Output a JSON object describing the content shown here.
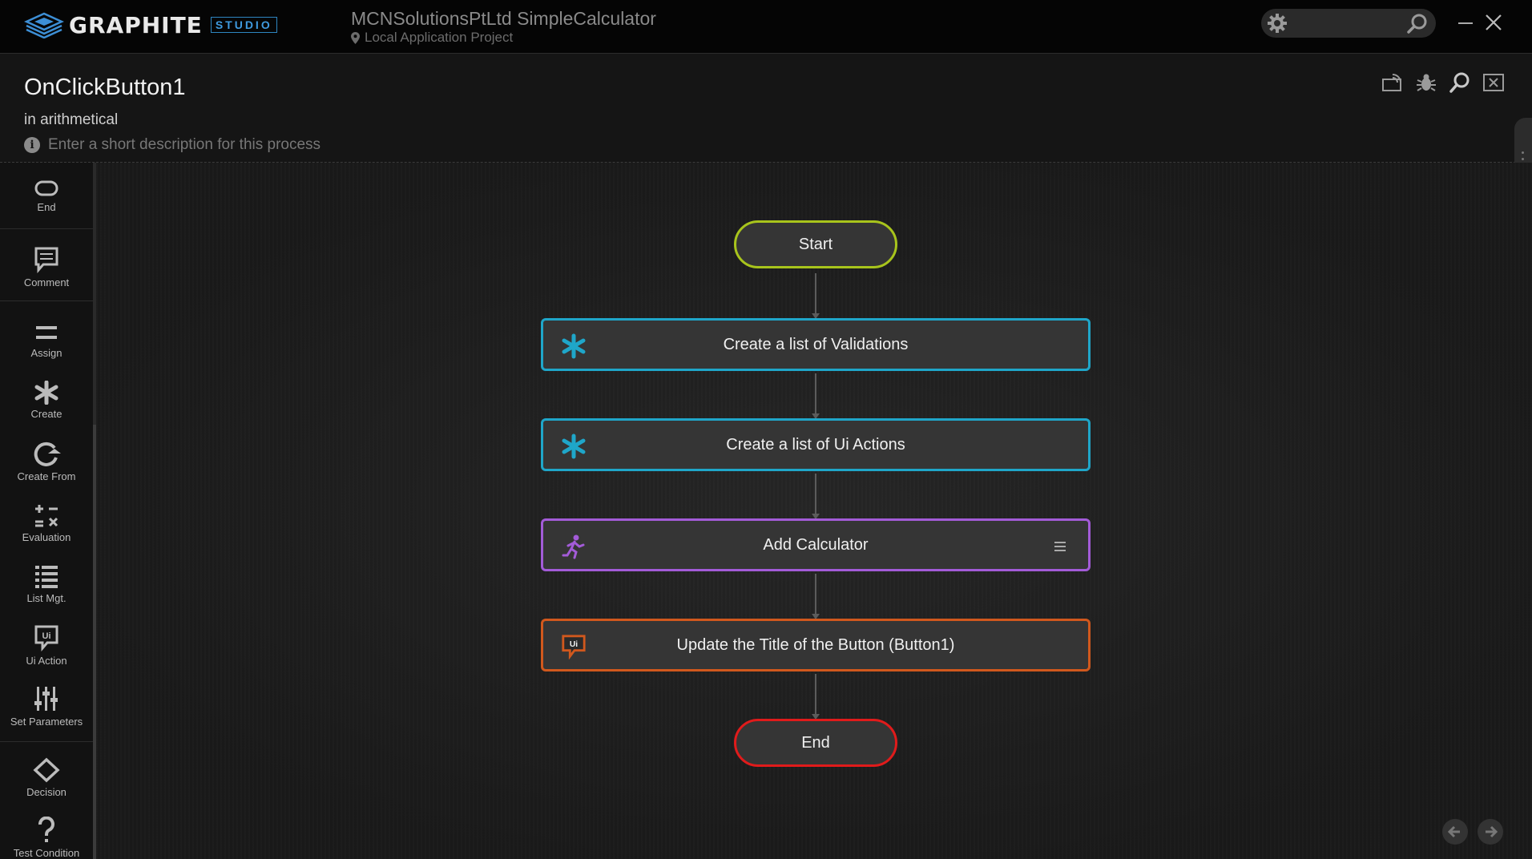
{
  "app": {
    "logo_text": "GRAPHITE",
    "logo_badge": "STUDIO",
    "project_title": "MCNSolutionsPtLtd SimpleCalculator",
    "project_subtitle": "Local Application Project"
  },
  "process": {
    "name": "OnClickButton1",
    "context": "in arithmetical",
    "description_placeholder": "Enter a short description for this process"
  },
  "toolbox": [
    {
      "id": "end",
      "label": "End",
      "icon": "oval-icon"
    },
    {
      "id": "comment",
      "label": "Comment",
      "icon": "comment-icon"
    },
    {
      "id": "assign",
      "label": "Assign",
      "icon": "equals-icon"
    },
    {
      "id": "create",
      "label": "Create",
      "icon": "asterisk-icon"
    },
    {
      "id": "create-from",
      "label": "Create From",
      "icon": "redo-icon"
    },
    {
      "id": "evaluation",
      "label": "Evaluation",
      "icon": "calculator-icon"
    },
    {
      "id": "list-mgt",
      "label": "List Mgt.",
      "icon": "list-icon"
    },
    {
      "id": "ui-action",
      "label": "Ui Action",
      "icon": "ui-bubble-icon"
    },
    {
      "id": "set-parameters",
      "label": "Set Parameters",
      "icon": "sliders-icon"
    },
    {
      "id": "decision",
      "label": "Decision",
      "icon": "diamond-icon"
    },
    {
      "id": "test-condition",
      "label": "Test Condition",
      "icon": "question-icon"
    }
  ],
  "flow": {
    "start_label": "Start",
    "end_label": "End",
    "steps": [
      {
        "label": "Create a list of Validations",
        "kind": "create",
        "color": "#1fa6c9",
        "icon": "asterisk-icon"
      },
      {
        "label": "Create a list of Ui Actions",
        "kind": "create",
        "color": "#1fa6c9",
        "icon": "asterisk-icon"
      },
      {
        "label": "Add Calculator",
        "kind": "run",
        "color": "#a35bd8",
        "icon": "running-figure-icon"
      },
      {
        "label": "Update the Title of the Button (Button1)",
        "kind": "ui-action",
        "color": "#d1581d",
        "icon": "ui-bubble-icon"
      }
    ],
    "start_color": "#a8c41c",
    "end_color": "#e01b1b"
  },
  "ui_icon_text": "Ui"
}
